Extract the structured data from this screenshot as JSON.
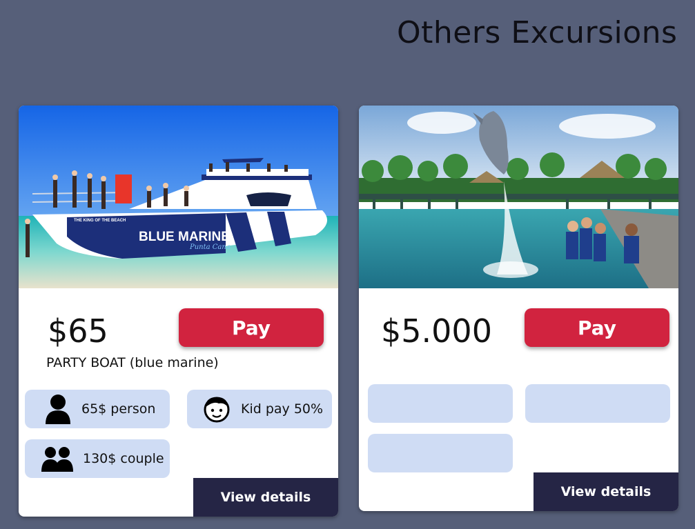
{
  "page": {
    "title": "Others Excursions"
  },
  "cards": [
    {
      "price": "$65",
      "pay_label": "Pay",
      "name": "PARTY BOAT (blue marine)",
      "photo": {
        "boat_text_main": "BLUE MARINE",
        "boat_text_script": "Punta Cana",
        "boat_text_tag": "THE KING OF THE BEACH"
      },
      "features": [
        {
          "icon": "person-icon",
          "label": "65$ person"
        },
        {
          "icon": "kid-face-icon",
          "label": "Kid pay 50%"
        },
        {
          "icon": "couple-icon",
          "label": "130$ couple"
        }
      ],
      "details_label": "View details"
    },
    {
      "price": "$5.000",
      "pay_label": "Pay",
      "features": [
        {
          "label": ""
        },
        {
          "label": ""
        },
        {
          "label": ""
        }
      ],
      "details_label": "View details"
    }
  ],
  "colors": {
    "background": "#565f79",
    "pay": "#d1233f",
    "chip": "#cfdcf4",
    "details": "#252545"
  }
}
